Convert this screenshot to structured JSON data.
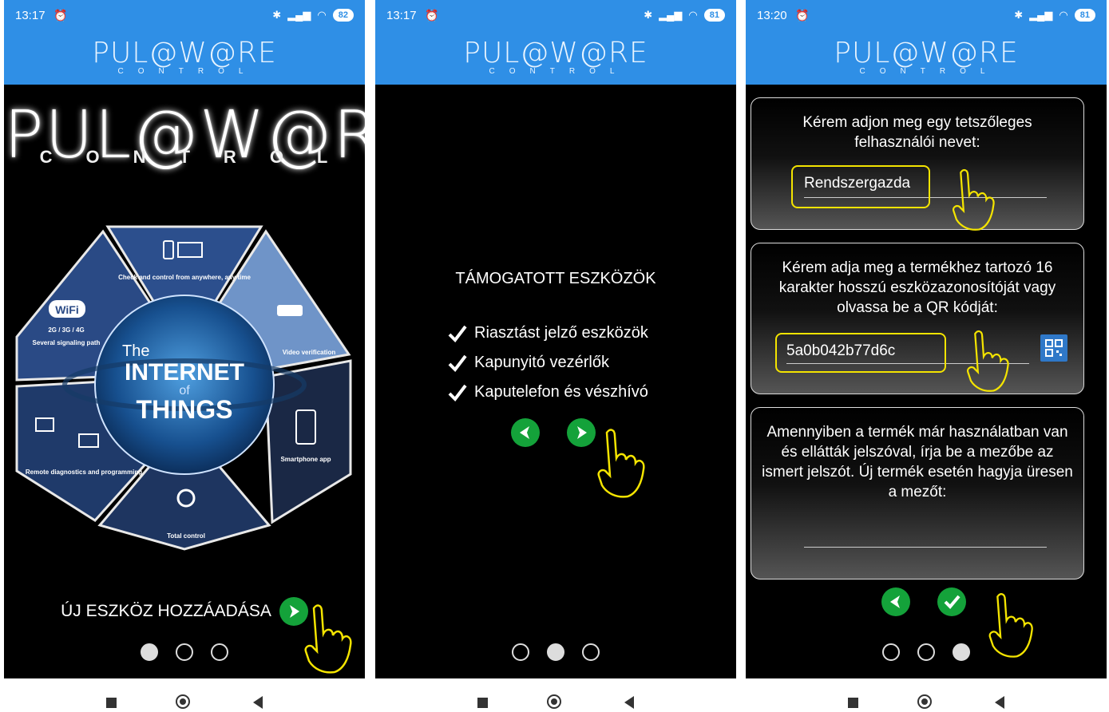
{
  "status": {
    "screen1": {
      "time": "13:17",
      "battery": "82"
    },
    "screen2": {
      "time": "13:17",
      "battery": "81"
    },
    "screen3": {
      "time": "13:20",
      "battery": "81"
    }
  },
  "app": {
    "logo": "PUL@W@RE",
    "logo_sub": "CONTROL"
  },
  "screen1": {
    "big_logo": "PUL@W@RE",
    "big_logo_sub": "CONTROL",
    "wheel": {
      "center_the": "The",
      "center_internet": "INTERNET",
      "center_of": "of",
      "center_things": "THINGS",
      "seg_top": "Check and control from anywhere, any time",
      "seg_top_right": "Video verification",
      "seg_right": "Smartphone app",
      "seg_bottom": "Total control",
      "seg_left_bottom": "Remote diagnostics and programming",
      "seg_left_top_badge": "WiFi",
      "seg_left_top_gen": "2G / 3G / 4G",
      "seg_left_top": "Several signaling path"
    },
    "cta": "ÚJ ESZKÖZ HOZZÁADÁSA"
  },
  "screen2": {
    "title": "TÁMOGATOTT ESZKÖZÖK",
    "items": [
      "Riasztást jelző eszközök",
      "Kapunyitó vezérlők",
      "Kaputelefon és vészhívó"
    ]
  },
  "screen3": {
    "card1_text": "Kérem adjon meg egy tetszőleges felhasználói nevet:",
    "username": "Rendszergazda",
    "card2_text": "Kérem adja meg a termékhez tartozó 16 karakter hosszú eszközazonosítóját vagy olvassa be a QR kódját:",
    "device_id": "5a0b042b77d6c",
    "card3_text": "Amennyiben a termék már használatban van és ellátták jelszóval, írja be a mezőbe az ismert jelszót. Új termék esetén hagyja üresen a mezőt:",
    "password": ""
  },
  "colors": {
    "accent": "#2f8fe6",
    "button_green": "#14a23a",
    "highlight": "#f4e400"
  },
  "icons": [
    "alarm-icon",
    "bluetooth-icon",
    "signal-icon",
    "wifi-icon",
    "battery-icon",
    "next-arrow-icon",
    "back-arrow-icon",
    "check-icon",
    "qr-scan-icon",
    "pointing-hand-icon"
  ]
}
